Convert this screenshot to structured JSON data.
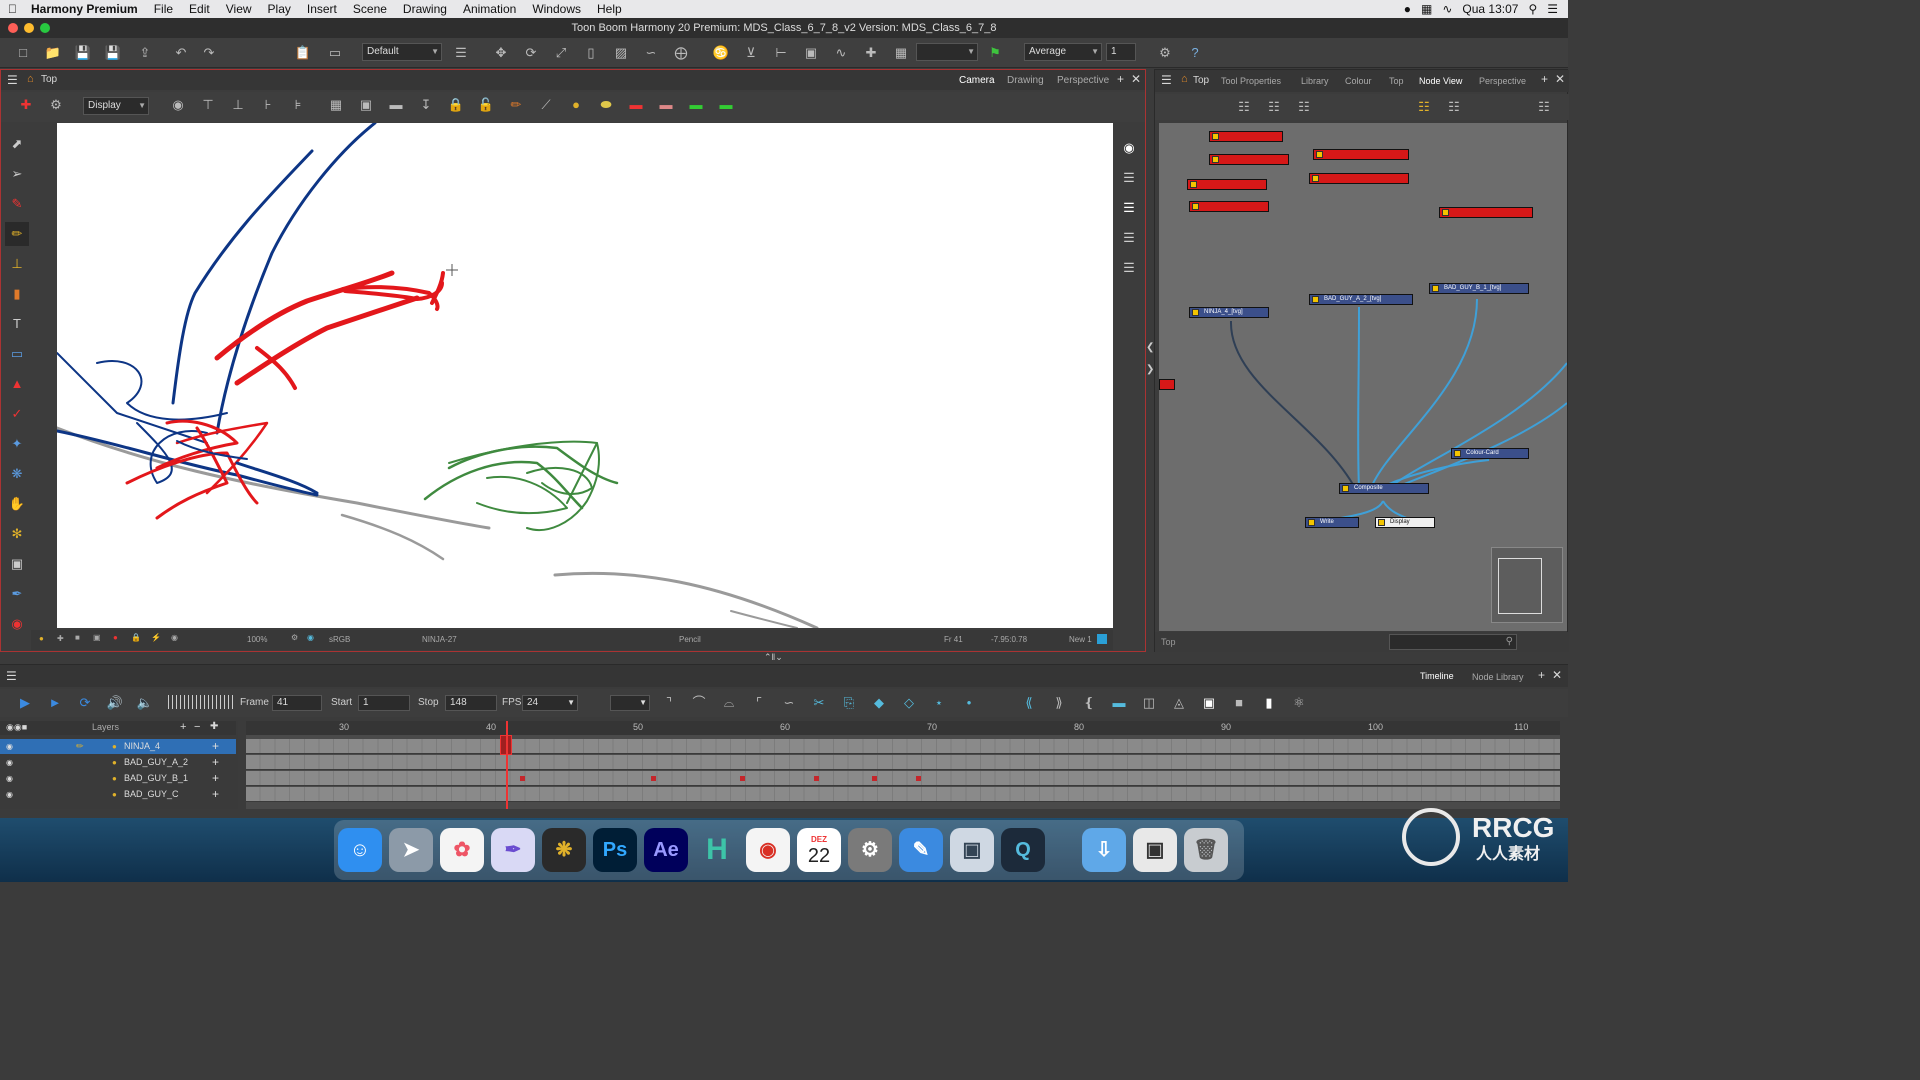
{
  "menubar": {
    "app_name": "Harmony Premium",
    "items": [
      "File",
      "Edit",
      "View",
      "Play",
      "Insert",
      "Scene",
      "Drawing",
      "Animation",
      "Windows",
      "Help"
    ],
    "clock": "Qua 13:07"
  },
  "window": {
    "title": "Toon Boom Harmony 20 Premium: MDS_Class_6_7_8_v2 Version: MDS_Class_6_7_8"
  },
  "toolbar": {
    "workspace": "Default",
    "smoothing": "Average",
    "value": "1"
  },
  "camera_panel": {
    "title": "Top",
    "tabs": [
      "Camera",
      "Drawing",
      "Perspective"
    ],
    "display_combo": "Display",
    "status": {
      "zoom": "100%",
      "colorspace": "sRGB",
      "drawing": "NINJA-27",
      "tool": "Pencil",
      "frame": "Fr 41",
      "coords": "-7.95:0.78",
      "new_label": "New 1"
    }
  },
  "node_panel": {
    "title": "Top",
    "tabs": [
      "Tool Properties",
      "Library",
      "Colour",
      "Top",
      "Node View",
      "Perspective"
    ],
    "nodes": [
      {
        "label": "NINJA_4_[tvg]",
        "kind": "blue"
      },
      {
        "label": "BAD_GUY_A_2_[tvg]",
        "kind": "blue"
      },
      {
        "label": "BAD_GUY_B_1_[tvg]",
        "kind": "blue"
      },
      {
        "label": "Colour-Card",
        "kind": "blue"
      },
      {
        "label": "Composite",
        "kind": "blue"
      },
      {
        "label": "Write",
        "kind": "blue"
      },
      {
        "label": "Display",
        "kind": "white"
      }
    ],
    "status_label": "Top"
  },
  "timeline": {
    "tabs": [
      "Timeline",
      "Node Library"
    ],
    "frame_label": "Frame",
    "frame": "41",
    "start_label": "Start",
    "start": "1",
    "stop_label": "Stop",
    "stop": "148",
    "fps_label": "FPS",
    "fps": "24",
    "layers_label": "Layers",
    "ruler": [
      "30",
      "40",
      "50",
      "60",
      "70",
      "80",
      "90",
      "100",
      "110"
    ],
    "layers": [
      {
        "name": "NINJA_4",
        "selected": true
      },
      {
        "name": "BAD_GUY_A_2",
        "selected": false
      },
      {
        "name": "BAD_GUY_B_1",
        "selected": false
      },
      {
        "name": "BAD_GUY_C",
        "selected": false
      }
    ]
  },
  "dock": {
    "apps": [
      "finder-icon",
      "launchpad-icon",
      "photos-icon",
      "brush-app-icon",
      "davinci-icon",
      "photoshop-icon",
      "after-effects-icon",
      "harmony-icon",
      "chrome-icon",
      "calendar-icon",
      "system-preferences-icon",
      "pen-app-icon",
      "preview-icon",
      "quicktime-icon",
      "downloads-folder-icon",
      "screenshot-icon",
      "trash-icon"
    ],
    "ps_label": "Ps",
    "ae_label": "Ae",
    "calendar_month": "DEZ",
    "calendar_day": "22"
  },
  "watermark": {
    "brand": "RRCG",
    "brand_sub": "人人素材"
  },
  "colors": {
    "accent_red": "#d61818",
    "node_blue": "#3b4f8a",
    "ninja_stroke": "#e3171b",
    "badguy_stroke": "#0d3585",
    "green_stroke": "#3f8a3f"
  }
}
